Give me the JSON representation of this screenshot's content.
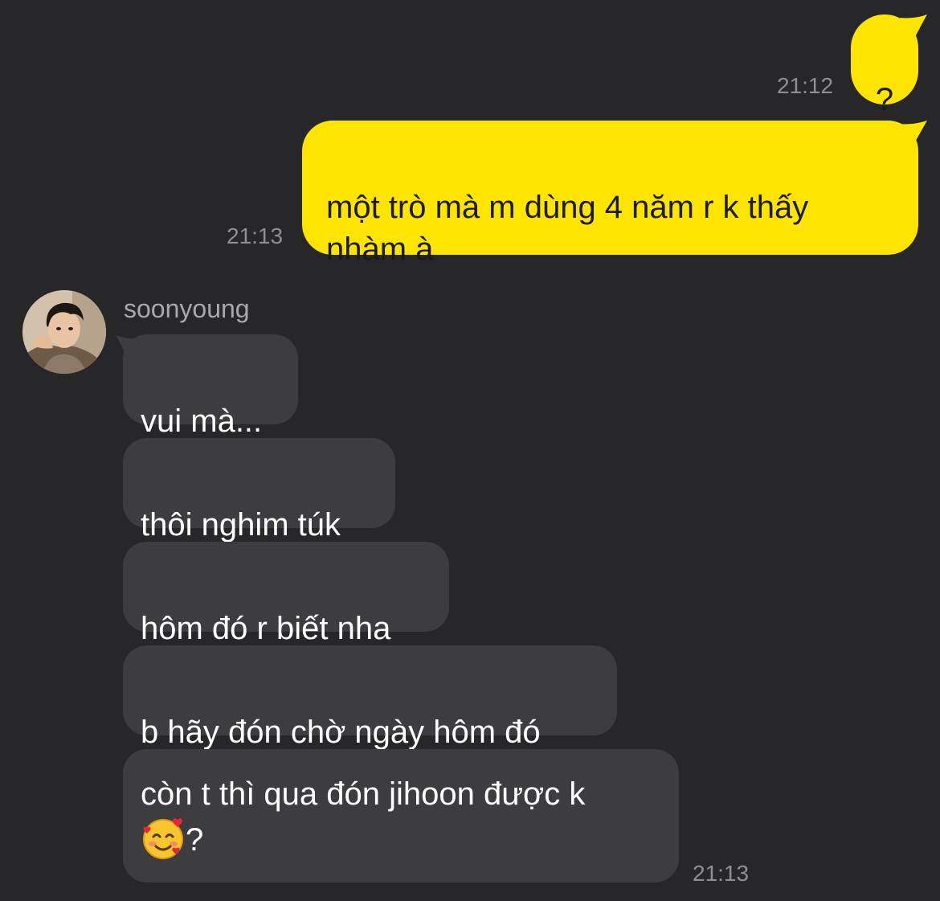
{
  "conversation": {
    "outgoing": [
      {
        "text": "?",
        "time": "21:12"
      },
      {
        "text": "một trò mà m dùng 4 năm r k thấy\nnhàm à",
        "time": "21:13"
      }
    ],
    "contact": {
      "name": "soonyoung",
      "avatar_icon": "profile-photo"
    },
    "incoming": [
      {
        "text": "vui mà..."
      },
      {
        "text": "thôi nghim túk"
      },
      {
        "text": "hôm đó r biết nha"
      },
      {
        "text": "b hãy đón chờ ngày hôm đó"
      },
      {
        "text": "còn t thì qua đón jihoon được k",
        "emoji_icon": "smiling-face-with-hearts",
        "after_emoji": "?",
        "time": "21:13"
      }
    ]
  },
  "colors": {
    "background": "#272729",
    "outgoing_bubble": "#FEE500",
    "incoming_bubble": "#3d3d40",
    "timestamp": "#8e8e93"
  }
}
